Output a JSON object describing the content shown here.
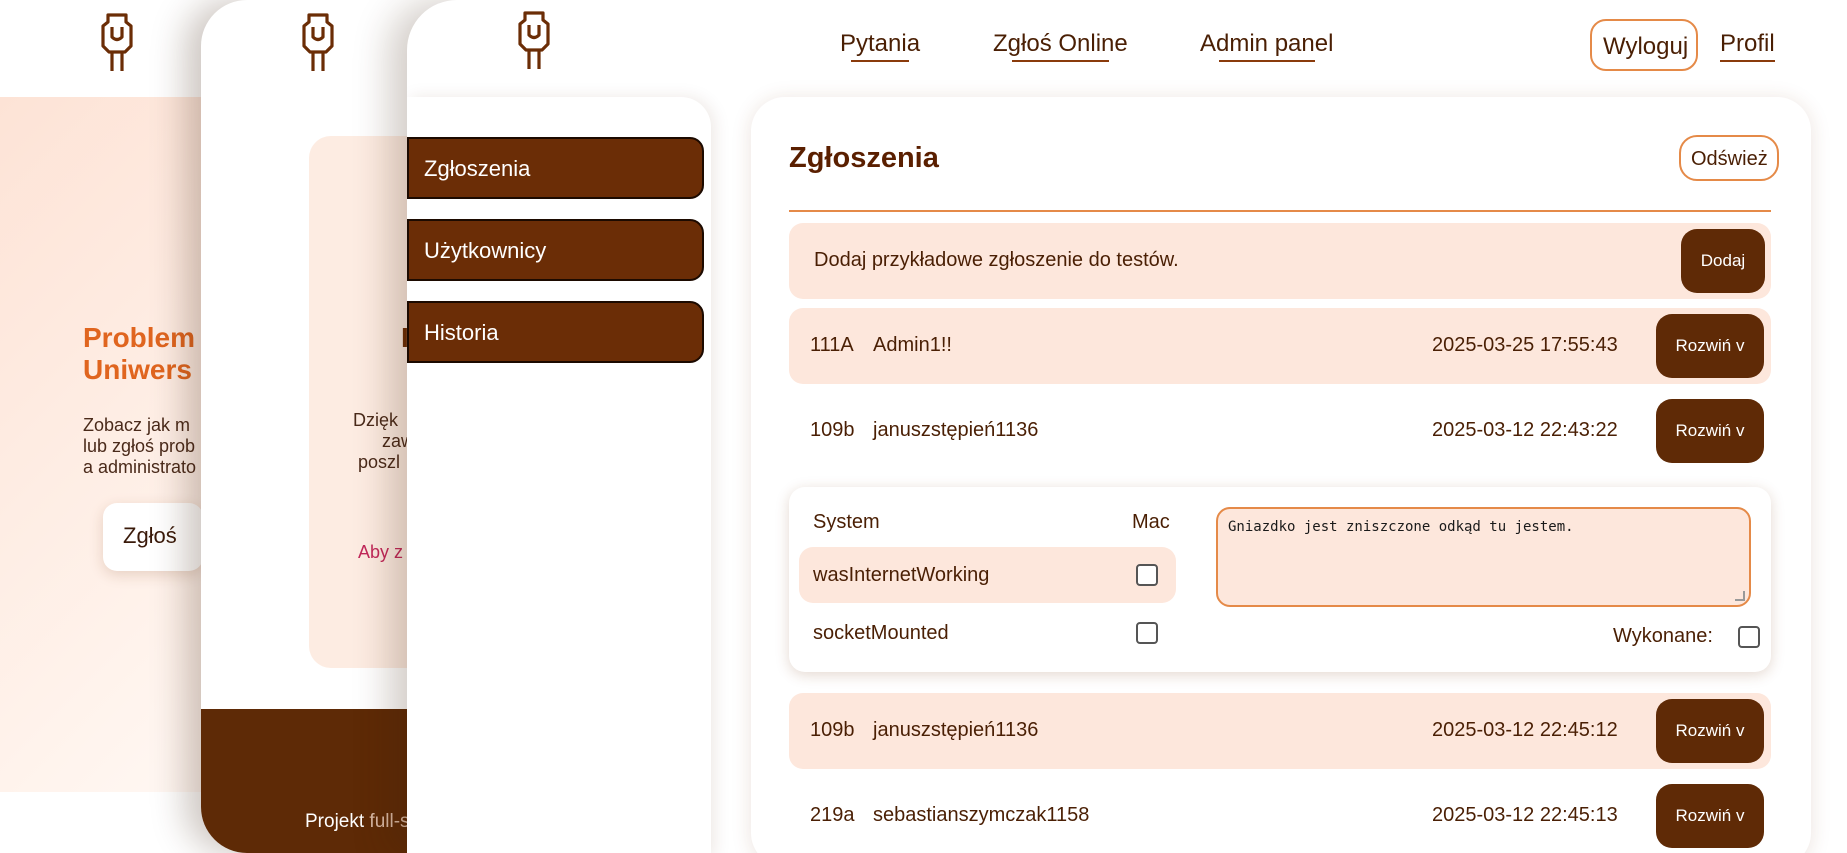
{
  "home": {
    "hero_title_line1": "Problem",
    "hero_title_line2": "Uniwers",
    "hero_text_line1": "Zobacz jak m",
    "hero_text_line2": "lub zgłoś prob",
    "hero_text_line3": "a administrato",
    "report_button": "Zgłoś"
  },
  "about": {
    "heading_fragment": "I",
    "text_line1": "Dzięk",
    "text_line2": "zaw",
    "text_line3": "poszl",
    "link_fragment": "Aby z",
    "footer_text": "Projekt",
    "footer_text_muted": "full-s"
  },
  "nav": {
    "questions": "Pytania",
    "report_online": "Zgłoś Online",
    "admin_panel": "Admin panel",
    "logout": "Wyloguj",
    "profile": "Profil"
  },
  "sidebar": {
    "items": [
      {
        "label": "Zgłoszenia"
      },
      {
        "label": "Użytkownicy"
      },
      {
        "label": "Historia"
      }
    ]
  },
  "main": {
    "title": "Zgłoszenia",
    "refresh_button": "Odśwież",
    "add_text": "Dodaj przykładowe zgłoszenie do testów.",
    "add_button": "Dodaj",
    "expand_label": "Rozwiń v",
    "tickets": [
      {
        "room": "111A",
        "user": "Admin1!!",
        "time": "2025-03-25 17:55:43"
      },
      {
        "room": "109b",
        "user": "januszstępień1136",
        "time": "2025-03-12 22:43:22"
      },
      {
        "room": "109b",
        "user": "januszstępień1136",
        "time": "2025-03-12 22:45:12"
      },
      {
        "room": "219a",
        "user": "sebastianszymczak1158",
        "time": "2025-03-12 22:45:13"
      }
    ],
    "detail": {
      "col_system": "System",
      "col_mac": "Mac",
      "flags": [
        {
          "name": "wasInternetWorking",
          "checked": false
        },
        {
          "name": "socketMounted",
          "checked": false
        }
      ],
      "note": "Gniazdko jest zniszczone odkąd tu jestem.",
      "done_label": "Wykonane:",
      "done_checked": false
    }
  },
  "colors": {
    "accent": "#e58a48",
    "dark_brown": "#6b2d06",
    "tint": "#fde7dc",
    "hero_orange": "#e0651f"
  }
}
